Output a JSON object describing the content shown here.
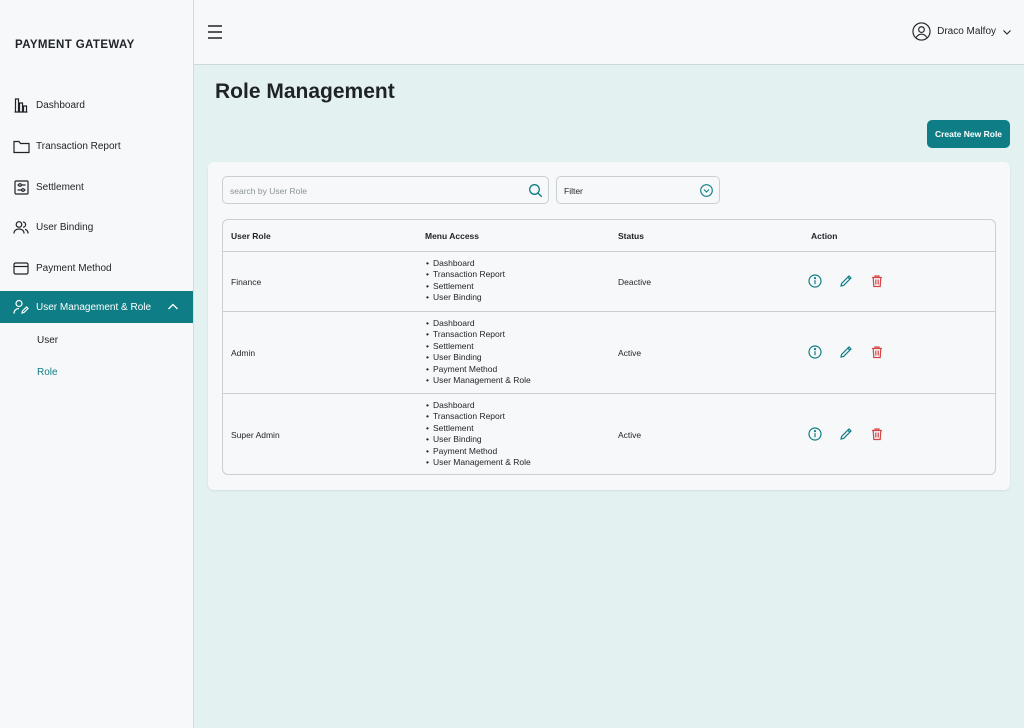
{
  "brand": "PAYMENT GATEWAY",
  "sidebar": {
    "items": [
      {
        "label": "Dashboard",
        "icon": "dashboard-icon"
      },
      {
        "label": "Transaction Report",
        "icon": "folder-icon"
      },
      {
        "label": "Settlement",
        "icon": "settlement-icon"
      },
      {
        "label": "User Binding",
        "icon": "users-icon"
      },
      {
        "label": "Payment Method",
        "icon": "card-icon"
      },
      {
        "label": "User Management & Role",
        "icon": "user-edit-icon",
        "active": true,
        "expanded": true
      }
    ],
    "sub_items": [
      {
        "label": "User"
      },
      {
        "label": "Role",
        "active": true
      }
    ]
  },
  "header": {
    "user_name": "Draco Malfoy"
  },
  "page": {
    "title": "Role Management",
    "create_button": "Create New Role"
  },
  "search": {
    "placeholder": "search by User Role",
    "value": ""
  },
  "filter": {
    "label": "Filter"
  },
  "table": {
    "headers": [
      "User Role",
      "Menu Access",
      "Status",
      "Action"
    ],
    "rows": [
      {
        "role": "Finance",
        "access": [
          "Dashboard",
          "Transaction Report",
          "Settlement",
          "User Binding"
        ],
        "status": "Deactive"
      },
      {
        "role": "Admin",
        "access": [
          "Dashboard",
          "Transaction Report",
          "Settlement",
          "User Binding",
          "Payment Method",
          "User Management & Role"
        ],
        "status": "Active"
      },
      {
        "role": "Super Admin",
        "access": [
          "Dashboard",
          "Transaction Report",
          "Settlement",
          "User Binding",
          "Payment Method",
          "User Management & Role"
        ],
        "status": "Active"
      }
    ]
  },
  "colors": {
    "accent": "#0f7d85",
    "danger": "#d64545",
    "background": "#e4f1f1",
    "surface": "#f6f8f9"
  }
}
